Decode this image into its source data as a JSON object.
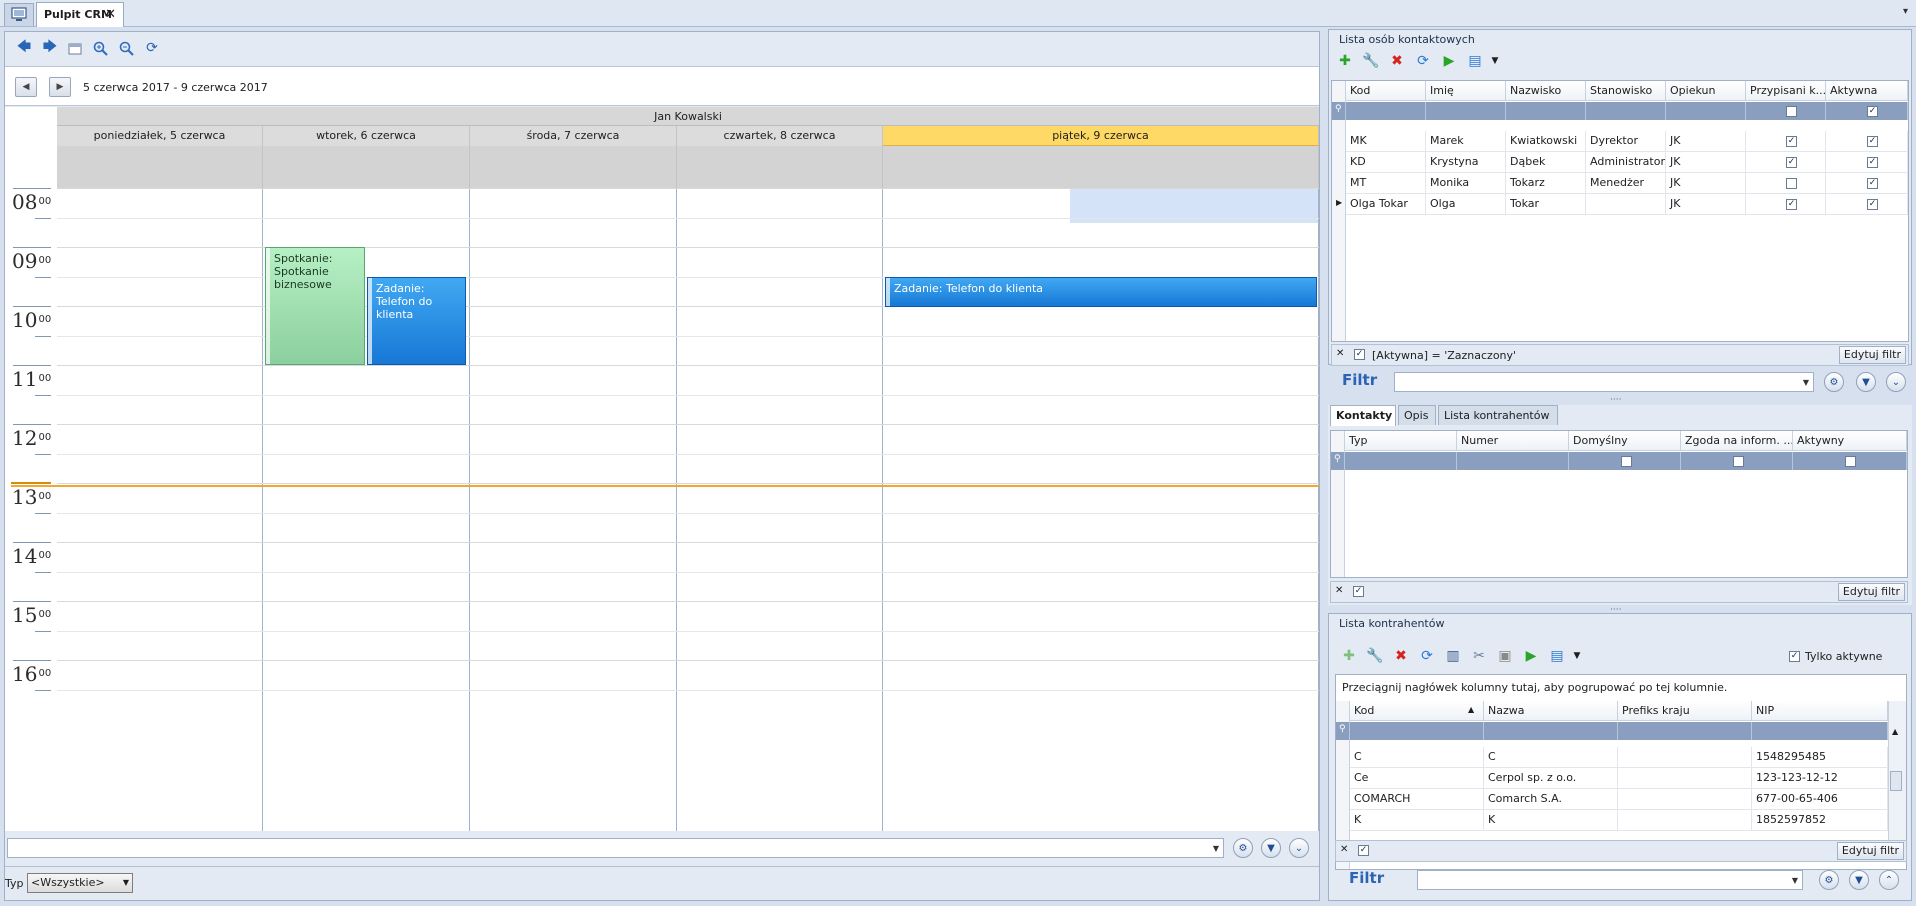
{
  "tabs": {
    "home_icon": "desktop-icon",
    "active_tab": "Pulpit CRM",
    "close": "✕",
    "menu": "▾"
  },
  "calendar": {
    "toolbar_icons": [
      "arrow-left-icon",
      "arrow-right-icon",
      "calendar-icon",
      "zoom-in-icon",
      "zoom-out-icon",
      "refresh-icon"
    ],
    "prev": "◀",
    "next": "▶",
    "date_range": "5 czerwca 2017 - 9 czerwca 2017",
    "owner": "Jan Kowalski",
    "days": [
      {
        "label": "poniedziałek, 5 czerwca",
        "today": false
      },
      {
        "label": "wtorek, 6 czerwca",
        "today": false
      },
      {
        "label": "środa, 7 czerwca",
        "today": false
      },
      {
        "label": "czwartek, 8 czerwca",
        "today": false
      },
      {
        "label": "piątek, 9 czerwca",
        "today": true
      }
    ],
    "hours": [
      "08",
      "09",
      "10",
      "11",
      "12",
      "13",
      "14",
      "15",
      "16"
    ],
    "minutes": "00",
    "appointments": [
      {
        "text": "Spotkanie: Spotkanie biznesowe",
        "type": "meeting",
        "color": "#9ee0b0"
      },
      {
        "text": "Zadanie: Telefon do klienta",
        "type": "task",
        "color": "#2b8fe4"
      },
      {
        "text": "Zadanie: Telefon do klienta",
        "type": "task",
        "color": "#2b8fe4"
      }
    ],
    "filter_value": "",
    "type_label": "Typ",
    "type_value": "<Wszystkie>"
  },
  "contacts": {
    "title": "Lista osób kontaktowych",
    "columns": [
      "Kod",
      "Imię",
      "Nazwisko",
      "Stanowisko",
      "Opiekun",
      "Przypisani k...",
      "Aktywna"
    ],
    "rows": [
      {
        "kod": "MK",
        "imie": "Marek",
        "nazwisko": "Kwiatkowski",
        "stanowisko": "Dyrektor",
        "opiekun": "JK",
        "przypisani": true,
        "aktywna": true
      },
      {
        "kod": "KD",
        "imie": "Krystyna",
        "nazwisko": "Dąbek",
        "stanowisko": "Administrator",
        "opiekun": "JK",
        "przypisani": true,
        "aktywna": true
      },
      {
        "kod": "MT",
        "imie": "Monika",
        "nazwisko": "Tokarz",
        "stanowisko": "Menedżer",
        "opiekun": "JK",
        "przypisani": false,
        "aktywna": true
      },
      {
        "kod": "Olga Tokar",
        "imie": "Olga",
        "nazwisko": "Tokar",
        "stanowisko": "",
        "opiekun": "JK",
        "przypisani": true,
        "aktywna": true
      }
    ],
    "filter_expr": "[Aktywna] = 'Zaznaczony'",
    "edit_filter": "Edytuj filtr",
    "filter_label": "Filtr",
    "filter_value": ""
  },
  "details": {
    "tabs": [
      "Kontakty",
      "Opis",
      "Lista kontrahentów"
    ],
    "columns": [
      "Typ",
      "Numer",
      "Domyślny",
      "Zgoda na inform. ...",
      "Aktywny"
    ],
    "edit_filter": "Edytuj filtr"
  },
  "contractors": {
    "title": "Lista kontrahentów",
    "only_active_label": "Tylko aktywne",
    "group_hint": "Przeciągnij nagłówek kolumny tutaj, aby pogrupować po tej kolumnie.",
    "columns": [
      "Kod",
      "Nazwa",
      "Prefiks kraju",
      "NIP"
    ],
    "rows": [
      {
        "kod": "C",
        "nazwa": "C",
        "prefiks": "",
        "nip": "1548295485"
      },
      {
        "kod": "Ce",
        "nazwa": "Cerpol sp. z o.o.",
        "prefiks": "",
        "nip": "123-123-12-12"
      },
      {
        "kod": "COMARCH",
        "nazwa": "Comarch S.A.",
        "prefiks": "",
        "nip": "677-00-65-406"
      },
      {
        "kod": "K",
        "nazwa": "K",
        "prefiks": "",
        "nip": "1852597852"
      }
    ],
    "edit_filter": "Edytuj filtr",
    "filter_label": "Filtr",
    "filter_value": ""
  }
}
